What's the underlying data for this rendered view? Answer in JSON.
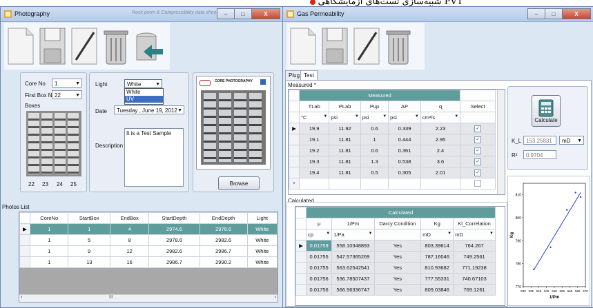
{
  "banner": {
    "text": "شبیه‌سازی تست‌های آزمایشگاهی PVT",
    "bullet_color": "#d42a1a"
  },
  "photo_window": {
    "title": "Photography",
    "center_title": "Rock porm & Compressibility data sheet",
    "controls": {
      "minimize": "–",
      "maximize": "□",
      "close": "X"
    },
    "toolbar": {
      "icons": [
        "new-file-icon",
        "save-icon",
        "edit-icon",
        "delete-icon",
        "import-icon"
      ]
    },
    "core_no_label": "Core No",
    "core_no_value": "1",
    "first_box_label": "First Box No",
    "first_box_value": "22",
    "boxes_label": "Boxes",
    "box_numbers": [
      "22",
      "23",
      "24",
      "25"
    ],
    "light_label": "Light",
    "light_value": "White",
    "light_options": [
      "White",
      "UV"
    ],
    "date_label": "Date",
    "date_value": "Tuesday ,    June    19, 2012",
    "description_label": "Description",
    "description_value": "It is a Test Sample",
    "preview_title": "CORE PHOTOGRAPHY",
    "browse_label": "Browse",
    "photos_list_label": "Photos List",
    "photos_columns": [
      "CoreNo",
      "StartBox",
      "EndBox",
      "StartDepth",
      "EndDepth",
      "Light"
    ],
    "photos_rows": [
      [
        "1",
        "1",
        "4",
        "2974.6",
        "2978.6",
        "White"
      ],
      [
        "1",
        "5",
        "8",
        "2978.6",
        "2982.6",
        "White"
      ],
      [
        "1",
        "9",
        "12",
        "2982.6",
        "2986.7",
        "White"
      ],
      [
        "1",
        "13",
        "16",
        "2986.7",
        "2990.2",
        "White"
      ]
    ],
    "scroll_mark": "III"
  },
  "gas_window": {
    "title": "Gas Permeability",
    "tabs": [
      "Plug",
      "Test"
    ],
    "measured_label": "Measured *",
    "measured_group": "Measured",
    "measured_columns": [
      "TLab",
      "PLab",
      "Pup",
      "ΔP",
      "q",
      "Select"
    ],
    "measured_units": [
      "°C",
      "psi",
      "psi",
      "psi",
      "cm³/s"
    ],
    "measured_rows": [
      [
        "19.9",
        "11.92",
        "0.6",
        "0.339",
        "2.23"
      ],
      [
        "19.1",
        "11.81",
        "1",
        "0.444",
        "2.95"
      ],
      [
        "19.2",
        "11.81",
        "0.6",
        "0.361",
        "2.4"
      ],
      [
        "19.3",
        "11.81",
        "1.3",
        "0.538",
        "3.6"
      ],
      [
        "19.4",
        "11.81",
        "0.5",
        "0.305",
        "2.01"
      ]
    ],
    "calculate_label": "Calculate",
    "kl_label": "K_L",
    "kl_value": "153.25831",
    "kl_unit": "mD",
    "r2_label": "R²",
    "r2_value": "0.9704",
    "calculated_label": "Calculated",
    "calculated_group": "Calculated",
    "calculated_columns": [
      "μ",
      "1/Pm",
      "Darcy Condition",
      "Kg",
      "Kl_Correlation"
    ],
    "calculated_units": [
      "cp",
      "1/Pa",
      "",
      "mD",
      "mD"
    ],
    "calculated_rows": [
      [
        "0.01759",
        "558.10348893",
        "Yes",
        "803.39614",
        "764.267"
      ],
      [
        "0.01755",
        "547.57365269",
        "Yes",
        "787.16046",
        "749.2561"
      ],
      [
        "0.01755",
        "563.62542541",
        "Yes",
        "810.93682",
        "771.19238"
      ],
      [
        "0.01756",
        "536.78507437",
        "Yes",
        "777.55331",
        "740.67103"
      ],
      [
        "0.01756",
        "566.96336747",
        "Yes",
        "809.03846",
        "769.1261"
      ]
    ],
    "accent_color": "#5f9c9c"
  },
  "chart_data": {
    "type": "scatter",
    "xlabel": "1/Pm",
    "ylabel": "Kg",
    "xlim": [
      530,
      570
    ],
    "ylim": [
      770,
      815
    ],
    "x_ticks": [
      "530",
      "535",
      "540",
      "545",
      "550",
      "555",
      "560",
      "565",
      "570"
    ],
    "y_ticks": [
      "770",
      "780",
      "790",
      "800",
      "810"
    ],
    "points": [
      [
        536.79,
        777.55
      ],
      [
        547.57,
        787.16
      ],
      [
        558.1,
        803.4
      ],
      [
        563.63,
        810.94
      ],
      [
        566.96,
        809.04
      ]
    ],
    "fit_line": [
      [
        536.79,
        777.3
      ],
      [
        566.96,
        811.0
      ]
    ],
    "point_color": "#2a3fd1",
    "line_color": "#2a3fd1"
  }
}
